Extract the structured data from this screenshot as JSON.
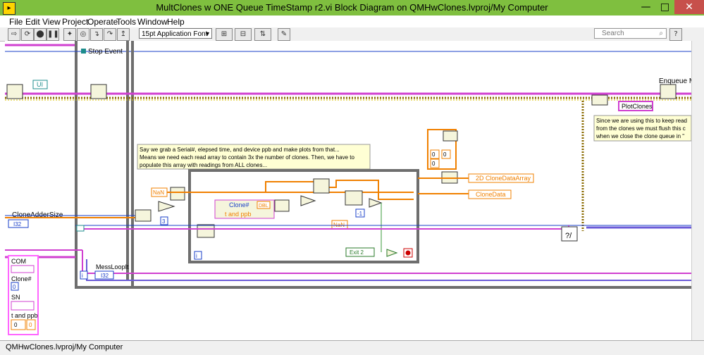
{
  "window": {
    "title": "MultClones w ONE Queue TimeStamp r2.vi Block Diagram on QMHwClones.lvproj/My Computer",
    "minimize": "—",
    "maximize": "□",
    "close": "✕"
  },
  "menu": [
    "File",
    "Edit",
    "View",
    "Project",
    "Operate",
    "Tools",
    "Window",
    "Help"
  ],
  "toolbar": {
    "font_select": "15pt Application Font",
    "search_placeholder": "Search"
  },
  "diagram": {
    "stop_event_label": "Stop Event",
    "ui_label": "UI",
    "enqueue_label": "Enqueue Me",
    "plotclones_string": "PlotClones",
    "comment_right_1": "Since we are using this to keep read",
    "comment_right_2": "from the clones we must flush this c",
    "comment_right_3": "when we close the clone queue in \"",
    "comment_main_1": "Say we grab a Serial#, elepsed time, and device ppb and make plots from that...",
    "comment_main_2": "Means we need each read array to contain 3x the number of clones.  Then, we have to",
    "comment_main_3": "populate this array with readings from ALL clones...",
    "nan_const_1": "NaN",
    "nan_const_2": "NaN",
    "three_const": "3",
    "neg_one_const": "-1",
    "clone_num_label": "Clone#",
    "t_and_ppb_label": "t and ppb",
    "dbl_label": "DBL",
    "clone_adder_label": "CloneAdderSize",
    "i32_label_1": "I32",
    "i32_label_2": "I32",
    "mess_loop_label": "MessLoopIt",
    "loop_iter_i_1": "i",
    "loop_iter_i_2": "i",
    "exit_label": "Exit 2",
    "array_2d_label": "2D CloneDataArray",
    "clonedata_label": "CloneData",
    "zero_1": "0",
    "zero_2": "0",
    "zero_3": "0",
    "cluster": {
      "com": "COM",
      "clone_num": "Clone#",
      "clone_val": "0",
      "sn": "SN",
      "t_and_ppb": "t and ppb",
      "t_val_1": "0",
      "t_val_2": "0"
    }
  },
  "status": {
    "path": "QMHwClones.lvproj/My Computer"
  },
  "colors": {
    "titlebar": "#7fbf3f",
    "close_button": "#c7504b",
    "wire_orange": "#f08000",
    "wire_blue": "#1a3fc8",
    "wire_pink": "#d040d0",
    "wire_brown": "#8a6a00",
    "structure_gray": "#6e6e6e"
  }
}
